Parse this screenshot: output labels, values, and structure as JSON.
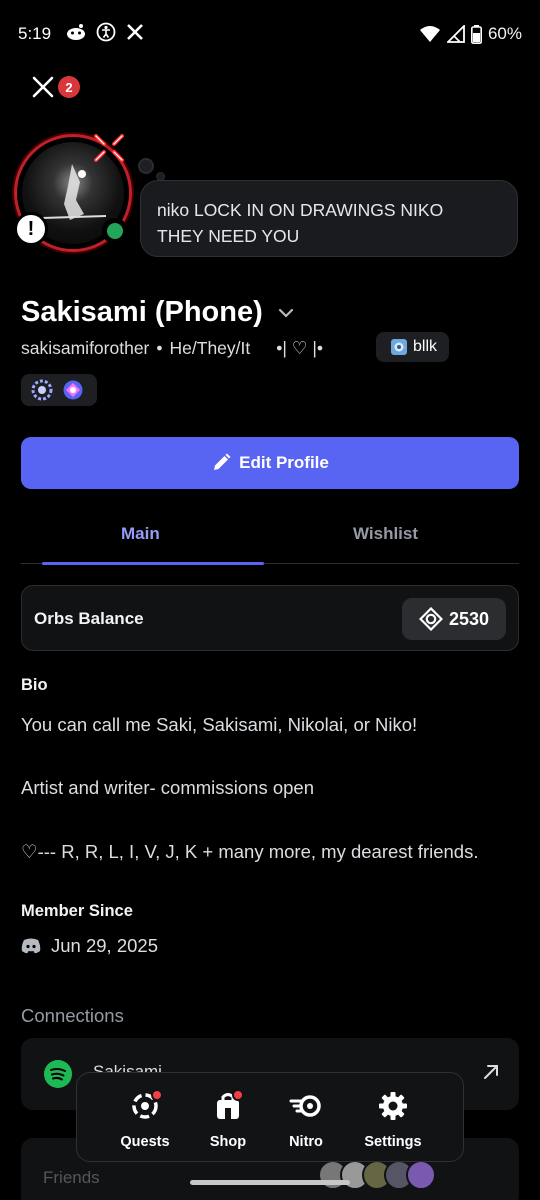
{
  "status_bar": {
    "time": "5:19",
    "battery": "60%",
    "icons": [
      "reddit-icon",
      "accessibility-icon",
      "x-icon",
      "wifi-icon",
      "signal-icon",
      "battery-icon"
    ]
  },
  "header": {
    "close_badge": "2"
  },
  "status_bubble": {
    "line1": "niko LOCK IN ON DRAWINGS NIKO",
    "line2": "THEY NEED YOU"
  },
  "profile": {
    "display_name": "Sakisami (Phone)",
    "username": "sakisamiforother",
    "separator": "•",
    "pronouns": "He/They/It",
    "custom_text": "•| ♡ |•",
    "tag": "bllk"
  },
  "edit_button": {
    "label": "Edit Profile"
  },
  "tabs": [
    {
      "label": "Main"
    },
    {
      "label": "Wishlist"
    }
  ],
  "orbs": {
    "label": "Orbs Balance",
    "value": "2530"
  },
  "bio": {
    "heading": "Bio",
    "lines": [
      "You can call me Saki, Sakisami, Nikolai, or Niko!",
      "Artist and writer- commissions open",
      "♡--- R, R, L, I, V, J, K + many more, my dearest friends."
    ]
  },
  "member_since": {
    "heading": "Member Since",
    "date": "Jun 29, 2025"
  },
  "connections": {
    "heading": "Connections",
    "items": [
      {
        "service": "spotify-icon",
        "name": "Sakisami"
      }
    ]
  },
  "friends": {
    "label": "Friends"
  },
  "bottom_nav": [
    {
      "label": "Quests"
    },
    {
      "label": "Shop"
    },
    {
      "label": "Nitro"
    },
    {
      "label": "Settings"
    }
  ],
  "colors": {
    "accent": "#5865f2",
    "online": "#23a55a",
    "badge": "#da373c",
    "background": "#000000"
  }
}
